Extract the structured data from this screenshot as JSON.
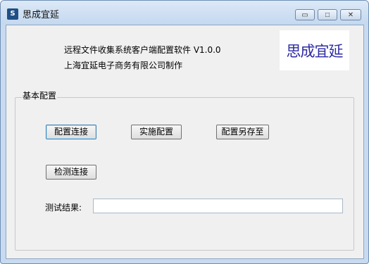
{
  "window": {
    "title": "思成宜延",
    "controls": {
      "minimize": "▭",
      "maximize": "□",
      "close": "✕"
    }
  },
  "header": {
    "line1": "远程文件收集系统客户端配置软件 V1.0.0",
    "line2": "上海宜延电子商务有限公司制作"
  },
  "logo": {
    "text": "思成宜延"
  },
  "group": {
    "title": "基本配置",
    "buttons": {
      "config_connect": "配置连接",
      "apply_config": "实施配置",
      "save_config_as": "配置另存至",
      "test_connect": "检测连接"
    },
    "result_label": "测试结果:",
    "result_value": ""
  }
}
